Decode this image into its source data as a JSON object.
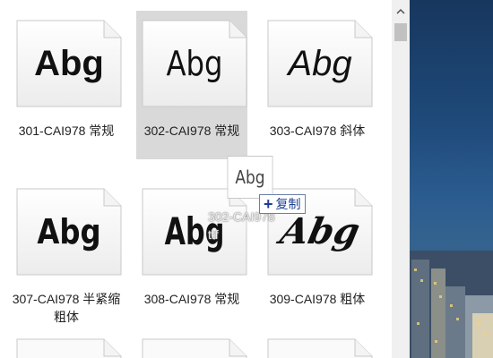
{
  "files": [
    {
      "label": "301-CAI978 常规",
      "preview": "Abg",
      "style": "bold",
      "selected": false
    },
    {
      "label": "302-CAI978 常规",
      "preview": "Abg",
      "style": "light",
      "selected": true
    },
    {
      "label": "303-CAI978 斜体",
      "preview": "Abg",
      "style": "italic",
      "selected": false
    },
    {
      "label": "307-CAI978 半紧缩 粗体",
      "preview": "Abg",
      "style": "semicond",
      "selected": false
    },
    {
      "label": "308-CAI978 常规",
      "preview": "Abg",
      "style": "cond",
      "selected": false
    },
    {
      "label": "309-CAI978 粗体",
      "preview": "Abg",
      "style": "script",
      "selected": false
    }
  ],
  "drag": {
    "preview": "Abg",
    "name": "302-CAI978\nttf",
    "action_label": "复制",
    "action_icon": "plus-icon"
  },
  "scrollbar": {
    "up_icon": "chevron-up-icon"
  },
  "colors": {
    "selection": "#d9d9d9",
    "copy_text": "#1b3f8f"
  }
}
